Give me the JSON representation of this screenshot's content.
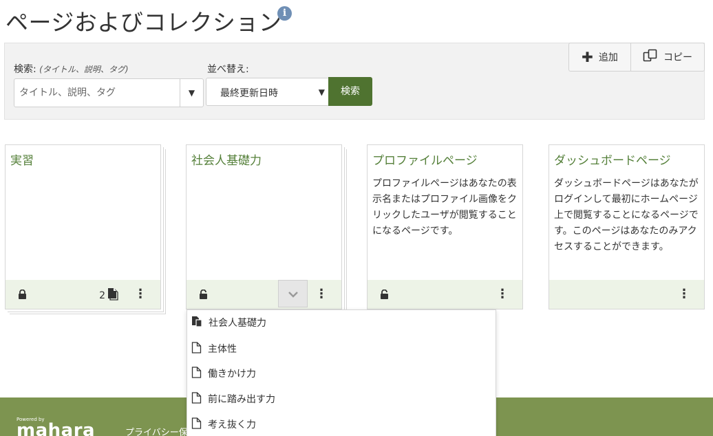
{
  "page": {
    "title": "ページおよびコレクション",
    "info_icon": "info-icon"
  },
  "search": {
    "label": "検索:",
    "label_hint": "(タイトル、説明、タグ)",
    "placeholder": "タイトル、説明、タグ",
    "sort_label": "並べ替え:",
    "sort_value": "最終更新日時",
    "button_label": "検索"
  },
  "actions": {
    "add_label": "追加",
    "copy_label": "コピー"
  },
  "cards": [
    {
      "title": "実習",
      "description": "",
      "locked": true,
      "page_count": "2",
      "stacked": true
    },
    {
      "title": "社会人基礎力",
      "description": "",
      "locked": false,
      "stacked": true,
      "expanded": true
    },
    {
      "title": "プロファイルページ",
      "description": "プロファイルページはあなたの表示名またはプロファイル画像をクリックしたユーザが閲覧することになるページです。",
      "locked": false
    },
    {
      "title": "ダッシュボードページ",
      "description": "ダッシュボードページはあなたがログインして最初にホームページ上で閲覧することになるページです。このページはあなたのみアクセスすることができます。",
      "locked": false
    }
  ],
  "dropdown": {
    "items": [
      {
        "label": "社会人基礎力",
        "icon": "collection-icon"
      },
      {
        "label": "主体性",
        "icon": "page-icon"
      },
      {
        "label": "働きかけ力",
        "icon": "page-icon"
      },
      {
        "label": "前に踏み出す力",
        "icon": "page-icon"
      },
      {
        "label": "考え抜く力",
        "icon": "page-icon"
      }
    ]
  },
  "footer": {
    "powered_by": "Powered by",
    "logo_text": "mahara",
    "link_privacy": "プライバシー保"
  },
  "colors": {
    "accent_green": "#4f7330",
    "title_green": "#55803a",
    "footer_green": "#7d9450",
    "card_footer_bg": "#edf3e7"
  }
}
